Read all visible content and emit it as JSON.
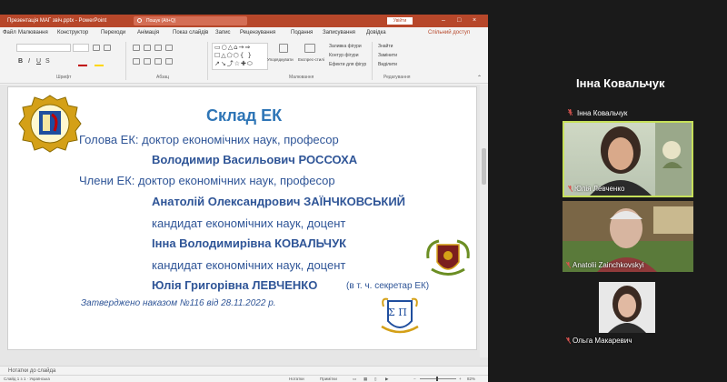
{
  "ppt": {
    "title": "Презентація МАГ звіч.pptx  -  PowerPoint",
    "search_placeholder": "Пошук (Alt+Q)",
    "login_label": "Увійти",
    "share_label": "Спільний доступ",
    "tabs": [
      "Файл",
      "Малювання",
      "Конструктор",
      "Переходи",
      "Анімація",
      "Показ слайдів",
      "Запис",
      "Рецензування",
      "Подання",
      "Записування",
      "Довідка"
    ],
    "ribbon": {
      "groups": [
        "Шрифт",
        "Абзац",
        "Малювання",
        "Редагування"
      ],
      "buttons": {
        "arrange": "Упорядкувати",
        "quick_styles": "Експрес-стилі",
        "shape_fill": "Заливка фігури",
        "shape_outline": "Контур фігури",
        "shape_effects": "Ефекти для фігур",
        "find": "Знайти",
        "replace": "Замінити",
        "select": "Виділити"
      }
    },
    "notes_label": "Нотатки до слайда",
    "status_left": "Слайд 1 з 1 · Українська",
    "status_buttons": [
      "Нотатки",
      "Примітки"
    ],
    "zoom_level": "82%"
  },
  "slide": {
    "title": "Склад ЕК",
    "lines": [
      {
        "text": "Голова ЕК: доктор економічних наук, професор",
        "style": "role"
      },
      {
        "text": "Володимир Васильович РОССОХА",
        "style": "name"
      },
      {
        "text": "Члени ЕК: доктор економічних наук, професор",
        "style": "role"
      },
      {
        "text": "Анатолій Олександрович ЗАЇНЧКОВСЬКИЙ",
        "style": "name"
      },
      {
        "text": "кандидат економічних наук, доцент",
        "style": "role"
      },
      {
        "text": "Інна Володимирівна КОВАЛЬЧУК",
        "style": "name"
      },
      {
        "text": "кандидат економічних наук, доцент",
        "style": "role"
      },
      {
        "text": "Юлія Григорівна ЛЕВЧЕНКО",
        "style": "name"
      }
    ],
    "secretary_note": "(в т. ч. секретар ЕК)",
    "approved": "Затверджено наказом №116 від 28.11.2022 р.",
    "emblem_text": "Σ П"
  },
  "participants": {
    "active_speaker": "Інна Ковальчук",
    "speaker_label": "Інна Ковальчук",
    "tiles": [
      {
        "name": "Юлія Левченко",
        "highlighted": true
      },
      {
        "name": "Anatolii Zainchkovskyi",
        "highlighted": false
      },
      {
        "name": "Ольга Макаревич",
        "highlighted": false
      }
    ]
  },
  "colors": {
    "ppt_accent": "#b7472a",
    "slide_text": "#2f5597",
    "slide_title": "#2e75b6",
    "active_tile_border": "#c6e05a",
    "muted_mic": "#d9534f"
  }
}
